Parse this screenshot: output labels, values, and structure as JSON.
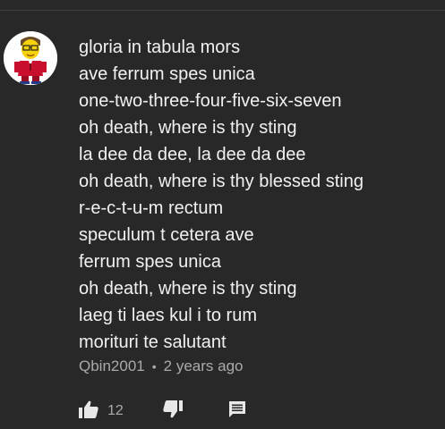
{
  "comment": {
    "lines": [
      "gloria in tabula mors",
      "ave ferrum spes unica",
      "one-two-three-four-five-six-seven",
      "oh death, where is thy sting",
      "la dee da dee, la dee da dee",
      "oh death, where is thy blessed sting",
      "r-e-c-t-u-m rectum",
      "speculum t cetera ave",
      "ferrum spes unica",
      "oh death, where is thy sting",
      "laeg ti laes kul i to rum",
      "morituri te salutant"
    ],
    "author": "Qbin2001",
    "separator": "•",
    "timestamp": "2 years ago",
    "like_count": "12"
  },
  "icons": {
    "like": "thumbs-up-icon",
    "dislike": "thumbs-down-icon",
    "reply": "reply-comment-icon"
  },
  "colors": {
    "background": "#282828",
    "text": "#f1f1f1",
    "meta_text": "#aaaaaa",
    "icon": "#e8e8e8"
  }
}
